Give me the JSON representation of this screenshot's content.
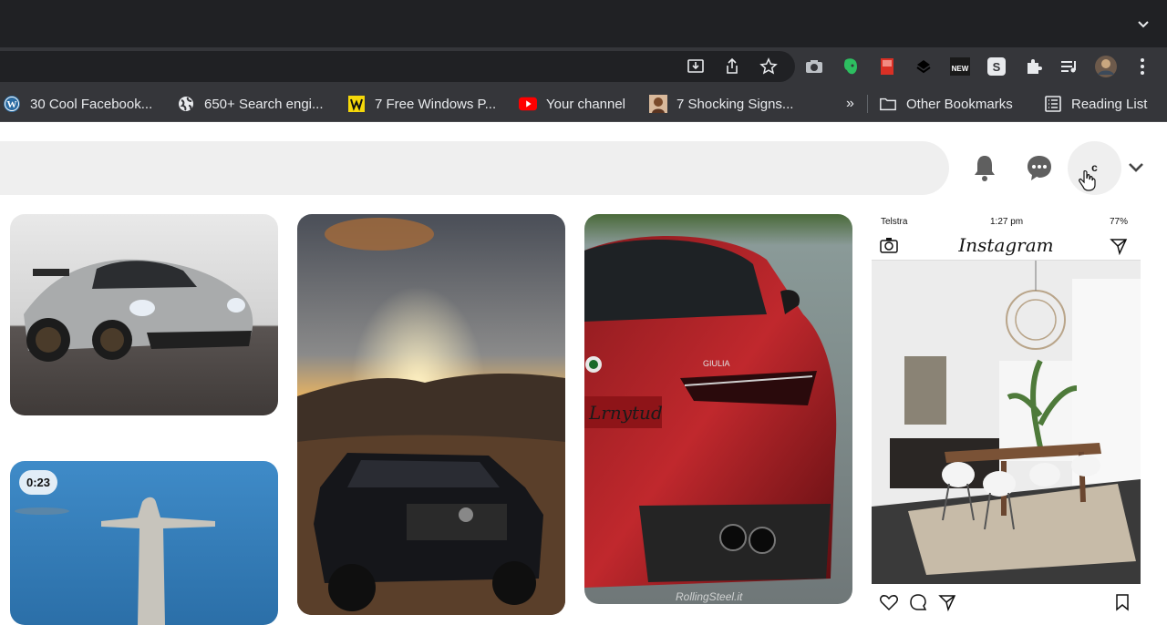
{
  "bookmarks": [
    {
      "label": "30 Cool Facebook...",
      "icon": "wordpress-icon"
    },
    {
      "label": "650+ Search engi...",
      "icon": "globe-icon"
    },
    {
      "label": "7 Free Windows P...",
      "icon": "wp-logo-icon"
    },
    {
      "label": "Your channel",
      "icon": "youtube-icon"
    },
    {
      "label": "7 Shocking Signs...",
      "icon": "person-photo-icon"
    }
  ],
  "bookmarks_overflow": "»",
  "other_bookmarks": "Other Bookmarks",
  "reading_list": "Reading List",
  "toolbar_badge": "NEW",
  "header": {
    "avatar_initial": "c"
  },
  "pins": [
    {
      "kind": "photo",
      "subject": "silver sports car"
    },
    {
      "kind": "photo",
      "subject": "black SUV at sunset"
    },
    {
      "kind": "photo",
      "subject": "red sedan rear",
      "watermark": "RollingSteel.it",
      "plate": "Lrnytud",
      "badge_text": "GIULIA"
    },
    {
      "kind": "instagram",
      "carrier": "Telstra",
      "time": "1:27 pm",
      "battery": "77%",
      "app": "Instagram"
    },
    {
      "kind": "video",
      "duration": "0:23",
      "subject": "statue"
    }
  ],
  "colors": {
    "chrome_dark": "#202124",
    "chrome_toolbar": "#35363a",
    "search_bg": "#efefef",
    "youtube_red": "#ff0000"
  }
}
